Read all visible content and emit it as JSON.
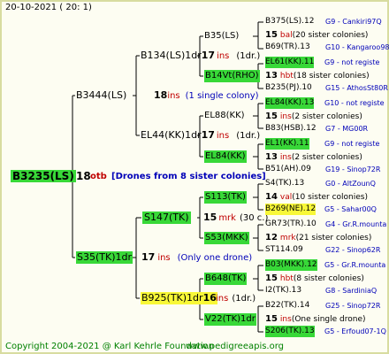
{
  "header": {
    "date": "20-10-2021 ( 20: 1)"
  },
  "root": {
    "id": "B3235(LS)",
    "year": "18",
    "breeder": "otb",
    "note": "[Drones from 8 sister colonies]"
  },
  "gen1": [
    {
      "id": "B3444(LS)",
      "year": "18",
      "breeder": "ins",
      "note": "(1 single colony)"
    },
    {
      "id": "S35(TK)1dr",
      "year": "17",
      "breeder": "ins",
      "note": "(Only one drone)"
    }
  ],
  "gen2": [
    {
      "id": "B134(LS)1dr",
      "year": "17",
      "breeder": "ins",
      "note": "(1dr.)"
    },
    {
      "id": "EL44(KK)1dr",
      "year": "17",
      "breeder": "ins",
      "note": "(1dr.)"
    },
    {
      "id": "S147(TK)",
      "year": "15",
      "breeder": "mrk",
      "note": "(30 c.)"
    },
    {
      "id": "B925(TK)1dr",
      "year": "16",
      "breeder": "ins",
      "note": "(1dr.)"
    }
  ],
  "gen3": [
    {
      "id": "B35(LS)"
    },
    {
      "id": "B14Vt(RHO)"
    },
    {
      "id": "EL88(KK)"
    },
    {
      "id": "EL84(KK)"
    },
    {
      "id": "S113(TK)"
    },
    {
      "id": "S53(MKK)"
    },
    {
      "id": "B648(TK)"
    },
    {
      "id": "V22(TK)1dr"
    }
  ],
  "gen4": [
    {
      "type": "id",
      "left": "B375(LS).12",
      "right": "G9 - Cankiri97Q",
      "hl": "none"
    },
    {
      "type": "info",
      "year": "15",
      "breeder": "bal",
      "note": "(20 sister colonies)"
    },
    {
      "type": "id",
      "left": "B69(TR).13",
      "right": "G10 - Kangaroo98R",
      "hl": "none"
    },
    {
      "type": "id",
      "left": "EL61(KK).11",
      "right": "G9 - not registe",
      "hl": "green"
    },
    {
      "type": "info",
      "year": "13",
      "breeder": "hbt",
      "note": "(18 sister colonies)"
    },
    {
      "type": "id",
      "left": "B235(PJ).10",
      "right": "G15 - AthosSt80R",
      "hl": "none"
    },
    {
      "type": "id",
      "left": "EL84(KK).13",
      "right": "G10 - not registe",
      "hl": "green"
    },
    {
      "type": "info",
      "year": "15",
      "breeder": "ins",
      "note": "(2 sister colonies)"
    },
    {
      "type": "id",
      "left": "B83(HSB).12",
      "right": "G7 - MG00R",
      "hl": "none"
    },
    {
      "type": "id",
      "left": "EL1(KK).11",
      "right": "G9 - not registe",
      "hl": "green"
    },
    {
      "type": "info",
      "year": "13",
      "breeder": "ins",
      "note": "(2 sister colonies)"
    },
    {
      "type": "id",
      "left": "B51(AH).09",
      "right": "G19 - Sinop72R",
      "hl": "none"
    },
    {
      "type": "id",
      "left": "S4(TK).13",
      "right": "G0 - AltZounQ",
      "hl": "none"
    },
    {
      "type": "info",
      "year": "14",
      "breeder": "val",
      "note": "(10 sister colonies)"
    },
    {
      "type": "id",
      "left": "B269(NE).12",
      "right": "G5 - Sahar00Q",
      "hl": "yellow"
    },
    {
      "type": "id",
      "left": "GR73(TR).10",
      "right": "G4 - Gr.R.mounta",
      "hl": "none"
    },
    {
      "type": "info",
      "year": "12",
      "breeder": "mrk",
      "note": "(21 sister colonies)"
    },
    {
      "type": "id",
      "left": "ST114.09",
      "right": "G22 - Sinop62R",
      "hl": "none"
    },
    {
      "type": "id",
      "left": "B03(MKK).12",
      "right": "G5 - Gr.R.mounta",
      "hl": "green"
    },
    {
      "type": "info",
      "year": "15",
      "breeder": "hbt",
      "note": "(8 sister colonies)"
    },
    {
      "type": "id",
      "left": "I2(TK).13",
      "right": "G8 - SardiniaQ",
      "hl": "none"
    },
    {
      "type": "id",
      "left": "B22(TK).14",
      "right": "G25 - Sinop72R",
      "hl": "none"
    },
    {
      "type": "info",
      "year": "15",
      "breeder": "ins",
      "note": "(One single drone)"
    },
    {
      "type": "id",
      "left": "S206(TK).13",
      "right": "G5 - Erfoud07-1Q",
      "hl": "green"
    }
  ],
  "colors": {
    "green": "#38d838",
    "yellow": "#f8f838",
    "blue": "#0000b8",
    "red": "#c00000",
    "footer": "#008000"
  },
  "footer": {
    "copyright": "Copyright 2004-2021 @ Karl Kehrle Foundation",
    "website": "www.pedigreeapis.org"
  }
}
